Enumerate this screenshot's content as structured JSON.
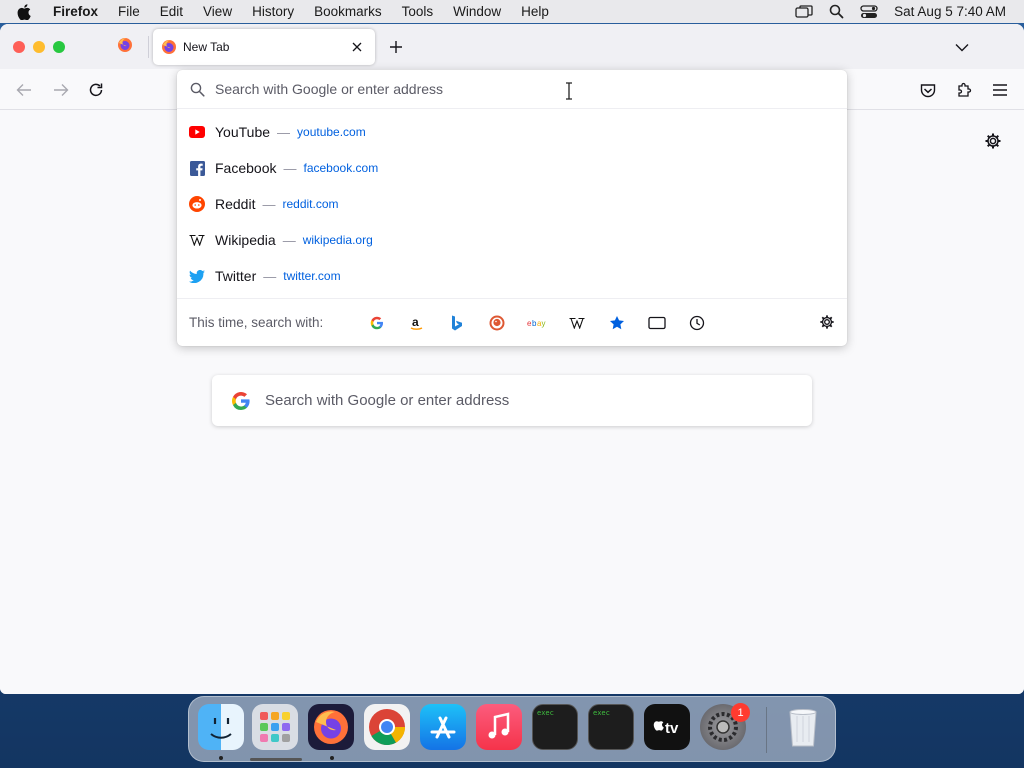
{
  "menubar": {
    "app_name": "Firefox",
    "items": [
      "File",
      "Edit",
      "View",
      "History",
      "Bookmarks",
      "Tools",
      "Window",
      "Help"
    ],
    "clock": "Sat Aug 5  7:40 AM"
  },
  "tabs": {
    "active_title": "New Tab"
  },
  "urlbar": {
    "placeholder": "Search with Google or enter address",
    "value": ""
  },
  "suggestions": [
    {
      "name": "YouTube",
      "url": "youtube.com",
      "icon": "youtube-icon",
      "color": "#ff0000"
    },
    {
      "name": "Facebook",
      "url": "facebook.com",
      "icon": "facebook-icon",
      "color": "#1877f2"
    },
    {
      "name": "Reddit",
      "url": "reddit.com",
      "icon": "reddit-icon",
      "color": "#ff4500"
    },
    {
      "name": "Wikipedia",
      "url": "wikipedia.org",
      "icon": "wikipedia-icon",
      "color": "#000000"
    },
    {
      "name": "Twitter",
      "url": "twitter.com",
      "icon": "twitter-icon",
      "color": "#1da1f2"
    }
  ],
  "search_with": {
    "label": "This time, search with:",
    "engines": [
      "google-icon",
      "amazon-icon",
      "bing-icon",
      "duckduckgo-icon",
      "ebay-icon",
      "wikipedia-icon",
      "bookmarks-icon",
      "tabs-icon",
      "history-icon"
    ]
  },
  "page": {
    "search_placeholder": "Search with Google or enter address"
  },
  "dock": {
    "apps": [
      "finder-icon",
      "launchpad-icon",
      "firefox-icon",
      "chrome-icon",
      "app-store-icon",
      "music-icon",
      "terminal-exec-icon",
      "terminal-exec-icon",
      "apple-tv-icon",
      "system-settings-icon",
      "trash-icon"
    ],
    "settings_badge": "1",
    "exec_label": "exec",
    "tv_label": "tv"
  },
  "colors": {
    "accent_link": "#0060df",
    "menubar_bg": "#e9e9ec",
    "window_bg": "#f9f9fb"
  }
}
